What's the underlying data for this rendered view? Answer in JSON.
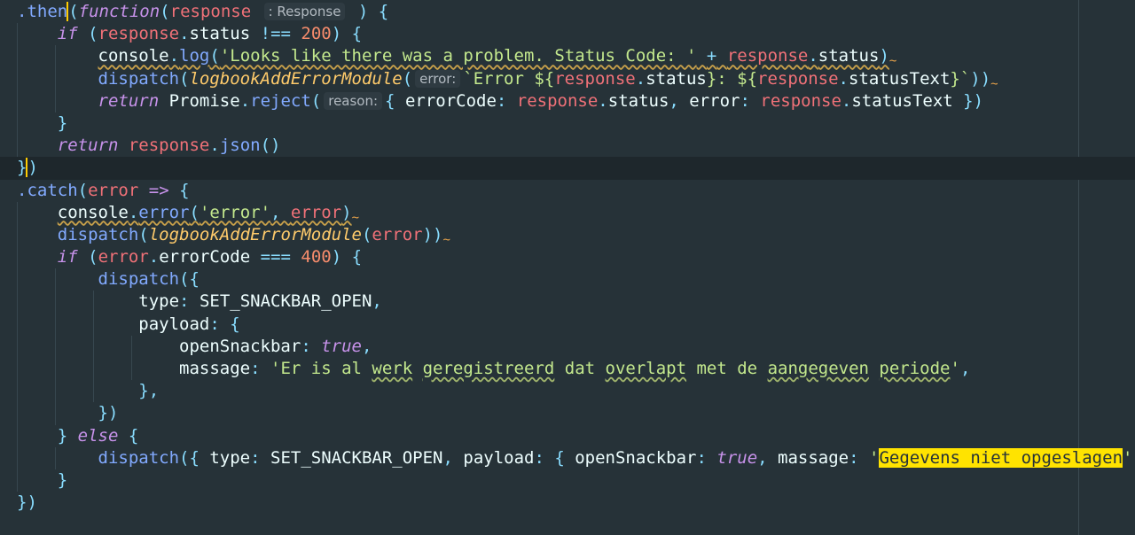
{
  "editor": {
    "hints": {
      "response_type": ": Response",
      "error_param": "error:",
      "reason_param": "reason:"
    },
    "tokens": {
      "then": ".then",
      "function": "function",
      "response": "response",
      "if": "if",
      "status": "status",
      "not_eq": "!==",
      "num_200": "200",
      "console": "console",
      "log": "log",
      "msg_problem": "'Looks like there was a problem. Status Code: '",
      "plus": "+",
      "dispatch": "dispatch",
      "logbook_fn": "logbookAddErrorModule",
      "template_start": "`Error ${",
      "template_mid": "}: ${",
      "template_end": "}`",
      "statusText": "statusText",
      "return": "return",
      "Promise": "Promise",
      "reject": "reject",
      "errorCode": "errorCode",
      "error_kw": "error",
      "json": "json",
      "catch": ".catch",
      "arrow": "=>",
      "error_fn": "error",
      "error_str": "'error'",
      "triple_eq": "===",
      "num_400": "400",
      "type": "type",
      "SET_SNACKBAR_OPEN": "SET_SNACKBAR_OPEN",
      "payload": "payload",
      "openSnackbar": "openSnackbar",
      "true": "true",
      "massage": "massage",
      "str_er_is_al": "'Er is al ",
      "word_werk": "werk",
      "word_geregistreerd": "geregistreerd",
      "word_dat": " dat ",
      "word_overlapt": "overlapt",
      "word_met_de": " met de ",
      "word_aangegeven": "aangegeven",
      "word_periode": "periode",
      "quote": "'",
      "str_gegevens": "Gegevens niet opgeslagen",
      "else": "else"
    },
    "colors": {
      "background": "#263238",
      "current_line": "#1e272c",
      "highlight": "#ffe300",
      "keyword_italic": "#c792ea",
      "function_call": "#82aaff",
      "parameter": "#f07178",
      "string": "#c3e88d",
      "number": "#f78c6c",
      "punctuation": "#89ddff"
    }
  }
}
